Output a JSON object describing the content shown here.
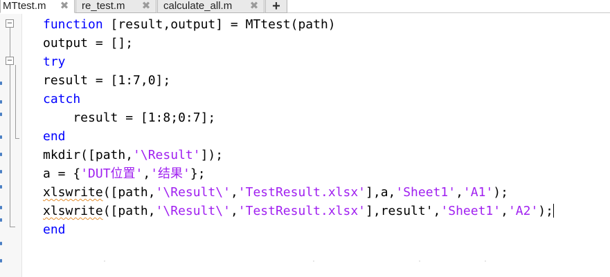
{
  "tabs": [
    {
      "label": "MTtest.m",
      "active": true
    },
    {
      "label": "re_test.m",
      "active": false
    },
    {
      "label": "calculate_all.m",
      "active": false
    }
  ],
  "tab_close_glyph": "✖",
  "new_tab_glyph": "+",
  "code": {
    "lines": [
      [
        {
          "t": "function",
          "c": "kw"
        },
        {
          "t": " [result,output] = MTtest(path)",
          "c": ""
        }
      ],
      [
        {
          "t": "output = [];",
          "c": ""
        }
      ],
      [
        {
          "t": "try",
          "c": "kw"
        }
      ],
      [
        {
          "t": "result = [1:7,0];",
          "c": ""
        }
      ],
      [
        {
          "t": "catch",
          "c": "kw"
        }
      ],
      [
        {
          "t": "    result = [1:8;0:7];",
          "c": ""
        }
      ],
      [
        {
          "t": "end",
          "c": "kw"
        }
      ],
      [
        {
          "t": "mkdir([path,",
          "c": ""
        },
        {
          "t": "'\\Result'",
          "c": "str"
        },
        {
          "t": "]);",
          "c": ""
        }
      ],
      [
        {
          "t": "a = {",
          "c": ""
        },
        {
          "t": "'DUT位置'",
          "c": "str"
        },
        {
          "t": ",",
          "c": ""
        },
        {
          "t": "'结果'",
          "c": "str"
        },
        {
          "t": "};",
          "c": ""
        }
      ],
      [
        {
          "t": "xlswrite",
          "c": "warn"
        },
        {
          "t": "([path,",
          "c": ""
        },
        {
          "t": "'\\Result\\'",
          "c": "str"
        },
        {
          "t": ",",
          "c": ""
        },
        {
          "t": "'TestResult.xlsx'",
          "c": "str"
        },
        {
          "t": "],a,",
          "c": ""
        },
        {
          "t": "'Sheet1'",
          "c": "str"
        },
        {
          "t": ",",
          "c": ""
        },
        {
          "t": "'A1'",
          "c": "str"
        },
        {
          "t": ");",
          "c": ""
        }
      ],
      [
        {
          "t": "xlswrite",
          "c": "warn"
        },
        {
          "t": "([path,",
          "c": ""
        },
        {
          "t": "'\\Result\\'",
          "c": "str"
        },
        {
          "t": ",",
          "c": ""
        },
        {
          "t": "'TestResult.xlsx'",
          "c": "str"
        },
        {
          "t": "],result',",
          "c": ""
        },
        {
          "t": "'Sheet1'",
          "c": "str"
        },
        {
          "t": ",",
          "c": ""
        },
        {
          "t": "'A2'",
          "c": "str"
        },
        {
          "t": ");",
          "c": ""
        }
      ],
      [
        {
          "t": "end",
          "c": "kw"
        }
      ]
    ],
    "cursor_line": 10
  },
  "colors": {
    "keyword": "#0000ff",
    "string": "#a020f0",
    "warning_underline": "#e38e2f"
  }
}
